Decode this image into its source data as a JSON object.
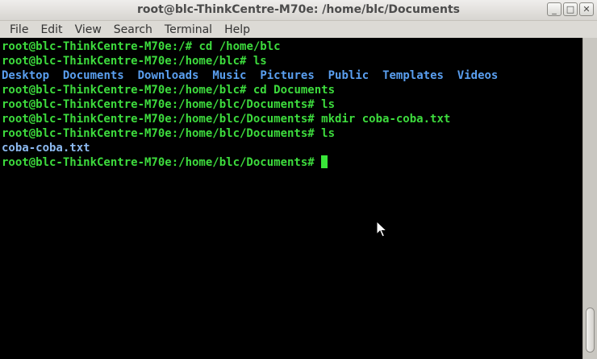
{
  "window": {
    "title": "root@blc-ThinkCentre-M70e: /home/blc/Documents",
    "minimize_label": "_",
    "maximize_label": "□",
    "close_label": "✕"
  },
  "menu": {
    "items": [
      "File",
      "Edit",
      "View",
      "Search",
      "Terminal",
      "Help"
    ]
  },
  "terminal": {
    "lines": [
      {
        "prompt": "root@blc-ThinkCentre-M70e:/# ",
        "cmd": "cd /home/blc"
      },
      {
        "prompt": "root@blc-ThinkCentre-M70e:/home/blc# ",
        "cmd": "ls"
      },
      {
        "dirs": [
          "Desktop",
          "Documents",
          "Downloads",
          "Music",
          "Pictures",
          "Public",
          "Templates",
          "Videos"
        ]
      },
      {
        "prompt": "root@blc-ThinkCentre-M70e:/home/blc# ",
        "cmd": "cd Documents"
      },
      {
        "prompt": "root@blc-ThinkCentre-M70e:/home/blc/Documents# ",
        "cmd": "ls"
      },
      {
        "prompt": "root@blc-ThinkCentre-M70e:/home/blc/Documents# ",
        "cmd": "mkdir coba-coba.txt"
      },
      {
        "prompt": "root@blc-ThinkCentre-M70e:/home/blc/Documents# ",
        "cmd": "ls"
      },
      {
        "file": "coba-coba.txt"
      },
      {
        "prompt": "root@blc-ThinkCentre-M70e:/home/blc/Documents# ",
        "cmd": "",
        "cursor": true
      }
    ]
  },
  "colors": {
    "prompt": "#3ddb3d",
    "directory": "#5a9ff0",
    "file": "#8cb9f0",
    "background": "#000000"
  }
}
